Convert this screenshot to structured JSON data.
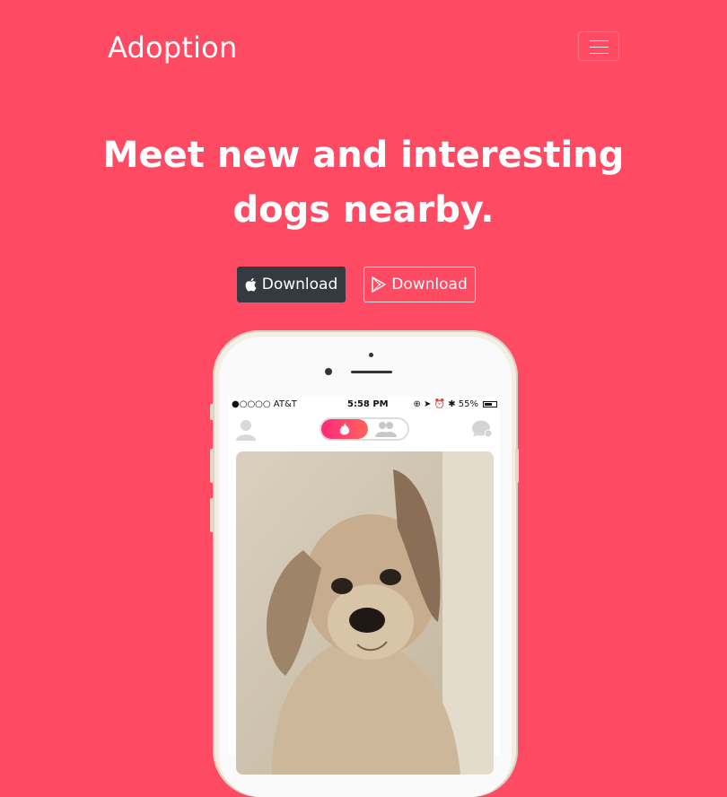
{
  "navbar": {
    "brand": "Adoption"
  },
  "hero": {
    "headline_line1": "Meet new and interesting",
    "headline_line2": "dogs nearby.",
    "apple_button": "Download",
    "play_button": "Download"
  },
  "phone": {
    "status": {
      "carrier": "●○○○○ AT&T",
      "time": "5:58 PM",
      "battery": "55%"
    }
  },
  "colors": {
    "background": "#ff4a63",
    "dark_button": "#343a40",
    "accent": "#fd297b"
  }
}
